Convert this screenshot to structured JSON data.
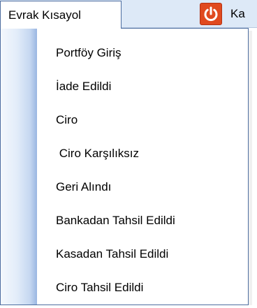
{
  "menubar": {
    "active_menu_label": "Evrak Kısayol",
    "power_icon": "power-icon",
    "power_color": "#e04a1f",
    "next_menu_label": "Ka"
  },
  "dropdown": {
    "items": [
      {
        "label": "Portföy Giriş"
      },
      {
        "label": "İade Edildi"
      },
      {
        "label": "Ciro"
      },
      {
        "label": " Ciro Karşılıksız"
      },
      {
        "label": "Geri Alındı"
      },
      {
        "label": "Bankadan Tahsil Edildi"
      },
      {
        "label": "Kasadan Tahsil Edildi"
      },
      {
        "label": "Ciro Tahsil Edildi"
      }
    ]
  }
}
